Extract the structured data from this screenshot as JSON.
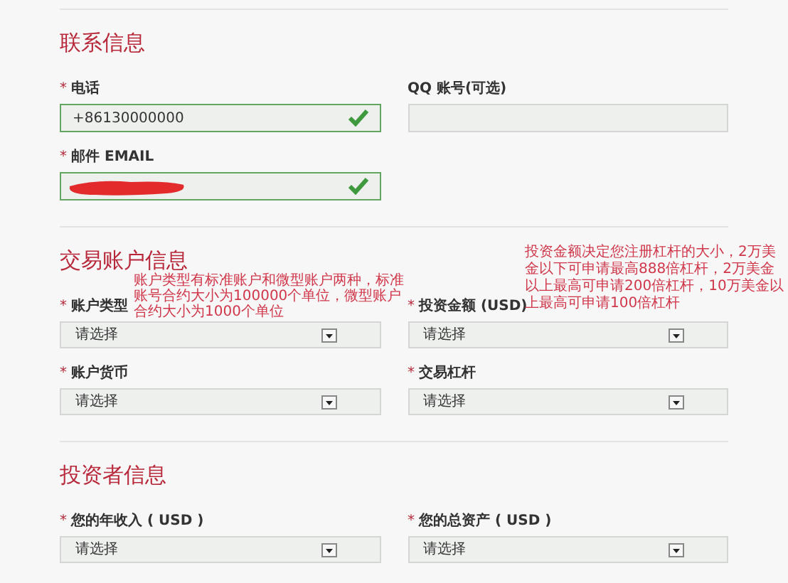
{
  "sections": [
    {
      "title": "联系信息",
      "rows": [
        [
          {
            "kind": "text",
            "marker": "*",
            "label": "电话",
            "value": "+86130000000",
            "valid": true,
            "redacted": false
          },
          {
            "kind": "text",
            "label": "QQ 账号(可选)",
            "valid": false,
            "redacted": false
          }
        ],
        [
          {
            "kind": "text",
            "marker": "*",
            "label": "邮件 EMAIL",
            "valid": true,
            "redacted": true
          }
        ]
      ]
    },
    {
      "title": "交易账户信息",
      "rows": [
        [
          {
            "kind": "select",
            "marker": "*",
            "label": "账户类型",
            "value": "请选择"
          },
          {
            "kind": "select",
            "marker": "*",
            "label": "投资金额 (USD)",
            "value": "请选择"
          }
        ],
        [
          {
            "kind": "select",
            "marker": "*",
            "label": "账户货币",
            "value": "请选择"
          },
          {
            "kind": "select",
            "marker": "*",
            "label": "交易杠杆",
            "value": "请选择"
          }
        ]
      ]
    },
    {
      "title": "投资者信息",
      "rows": [
        [
          {
            "kind": "select",
            "marker": "*",
            "label": "您的年收入 ( USD )",
            "value": "请选择"
          },
          {
            "kind": "select",
            "marker": "*",
            "label": "您的总资产 ( USD )",
            "value": "请选择"
          }
        ]
      ]
    }
  ],
  "annotations": [
    {
      "text": "账户类型有标准账户和微型账户两种，标准账号合约大小为100000个单位，微型账户合约大小为1000个单位"
    },
    {
      "text": "投资金额决定您注册杠杆的大小，2万美金以下可申请最高888倍杠杆，2万美金以上最高可申请200倍杠杆，10万美金以上最高可申请100倍杠杆"
    }
  ]
}
